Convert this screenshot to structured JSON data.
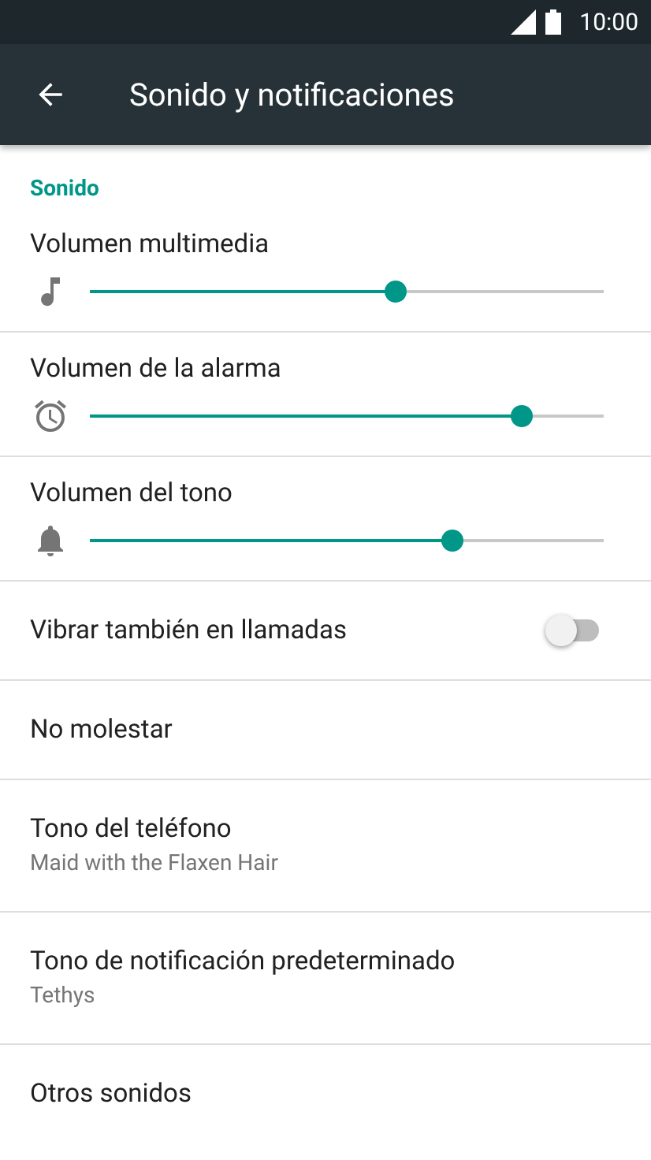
{
  "status_bar": {
    "time": "10:00"
  },
  "toolbar": {
    "title": "Sonido y notificaciones"
  },
  "section": {
    "title": "Sonido"
  },
  "items": [
    {
      "kind": "slider",
      "label": "Volumen multimedia",
      "level": 0.6
    },
    {
      "kind": "slider",
      "label": "Volumen de la alarma",
      "level": 0.856
    },
    {
      "kind": "slider",
      "label": "Volumen del tono",
      "level": 0.715
    },
    {
      "kind": "switch",
      "label": "Vibrar también en llamadas",
      "on": false
    },
    {
      "kind": "plain",
      "label": "No molestar"
    },
    {
      "kind": "plain",
      "label": "Tono del teléfono",
      "summary": "Maid with the Flaxen Hair"
    },
    {
      "kind": "plain",
      "label": "Tono de notificación predeterminado",
      "summary": "Tethys"
    },
    {
      "kind": "plain",
      "label": "Otros sonidos"
    }
  ]
}
